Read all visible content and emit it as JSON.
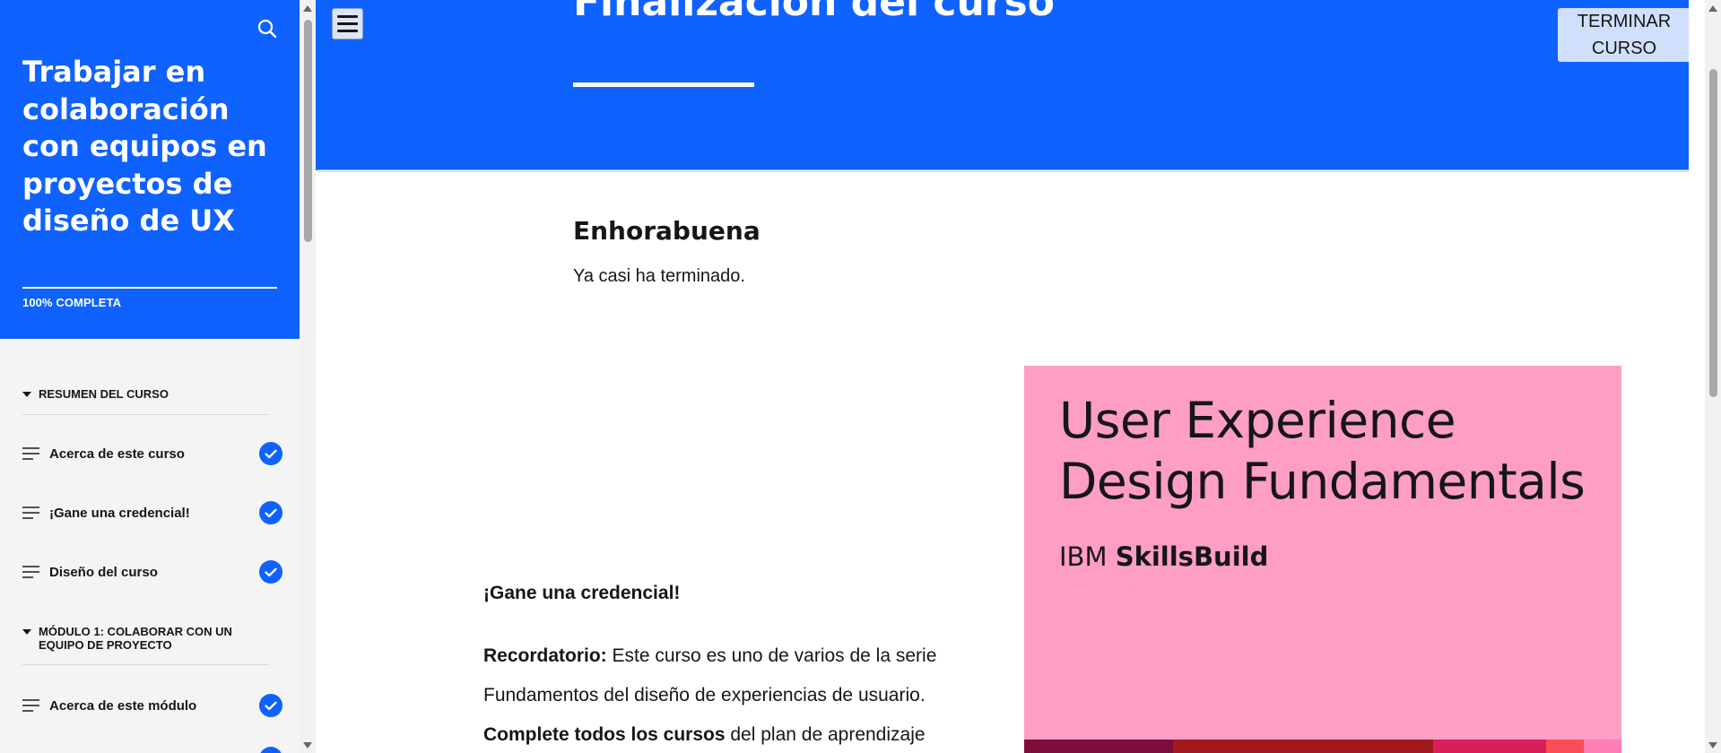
{
  "sidebar": {
    "course_title": "Trabajar en colaboración con equipos en proyectos de diseño de UX",
    "progress": "100% COMPLETA",
    "progress_value": 100,
    "sections": [
      {
        "title": "RESUMEN DEL CURSO",
        "items": [
          {
            "label": "Acerca de este curso",
            "completed": true
          },
          {
            "label": "¡Gane una credencial!",
            "completed": true
          },
          {
            "label": "Diseño del curso",
            "completed": true
          }
        ]
      },
      {
        "title": "MÓDULO 1: COLABORAR CON UN EQUIPO DE PROYECTO",
        "items": [
          {
            "label": "Acerca de este módulo",
            "completed": true
          }
        ]
      }
    ]
  },
  "header": {
    "title": "Finalización del curso",
    "finish_button": "TERMINAR CURSO"
  },
  "content": {
    "congrats_heading": "Enhorabuena",
    "congrats_text": "Ya casi ha terminado.",
    "credential_heading": "¡Gane una credencial!",
    "reminder_label": "Recordatorio:",
    "reminder_text": " Este curso es uno de varios de la serie Fundamentos del diseño de experiencias de usuario.",
    "complete_bold": "Complete todos los cursos",
    "complete_text": " del plan de aprendizaje"
  },
  "badge": {
    "title_line1": "User Experience",
    "title_line2": "Design Fundamentals",
    "brand_prefix": "IBM ",
    "brand_name": "SkillsBuild",
    "background_color": "#ff9ec5",
    "stripe_colors": [
      "#7d0d3a",
      "#a2191f",
      "#da1e5b",
      "#fa4d56",
      "#ff7eb6"
    ]
  },
  "colors": {
    "brand_blue": "#0f62fe",
    "sidebar_bg": "#f4f4f4",
    "button_bg": "#d0e0fc"
  }
}
